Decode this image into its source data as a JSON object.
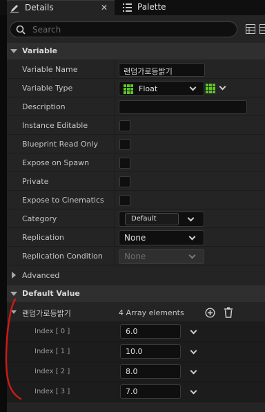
{
  "tabs": [
    {
      "label": "Details",
      "icon": "pencil-icon",
      "active": true
    },
    {
      "label": "Palette",
      "icon": "list-icon",
      "active": false
    }
  ],
  "search": {
    "placeholder": "Search"
  },
  "sections": {
    "variable": "Variable",
    "advanced": "Advanced",
    "default_value": "Default Value"
  },
  "rows": {
    "variable_name": {
      "label": "Variable Name",
      "value": "랜덤가로등밝기"
    },
    "variable_type": {
      "label": "Variable Type",
      "value": "Float",
      "color": "#5ec826"
    },
    "description": {
      "label": "Description",
      "value": ""
    },
    "instance_editable": {
      "label": "Instance Editable",
      "checked": false
    },
    "blueprint_read_only": {
      "label": "Blueprint Read Only",
      "checked": false
    },
    "expose_on_spawn": {
      "label": "Expose on Spawn",
      "checked": false
    },
    "private": {
      "label": "Private",
      "checked": false
    },
    "expose_to_cinematics": {
      "label": "Expose to Cinematics",
      "checked": false
    },
    "category": {
      "label": "Category",
      "value": "Default"
    },
    "replication": {
      "label": "Replication",
      "value": "None"
    },
    "replication_condition": {
      "label": "Replication Condition",
      "value": "None"
    }
  },
  "array": {
    "name": "랜덤가로등밝기",
    "count_label": "4 Array elements",
    "elements": [
      {
        "label": "Index [ 0 ]",
        "value": "6.0"
      },
      {
        "label": "Index [ 1 ]",
        "value": "10.0"
      },
      {
        "label": "Index [ 2 ]",
        "value": "8.0"
      },
      {
        "label": "Index [ 3 ]",
        "value": "7.0"
      }
    ]
  },
  "colors": {
    "accent_green": "#5ec826",
    "annotation_red": "#d01818"
  }
}
